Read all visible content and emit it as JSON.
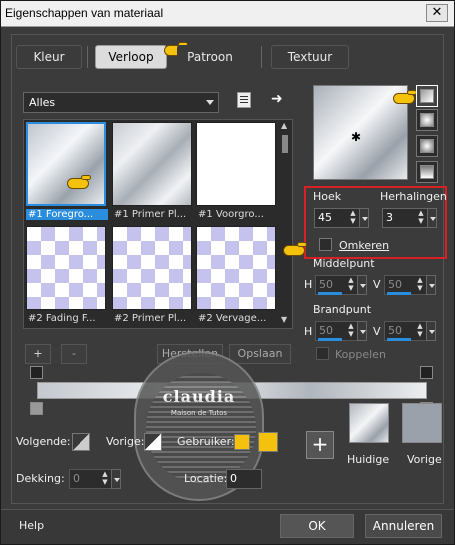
{
  "window": {
    "title": "Eigenschappen van materiaal",
    "close": "✕"
  },
  "tabs": [
    {
      "label": "Kleur"
    },
    {
      "label": "Verloop"
    },
    {
      "label": "Patroon"
    },
    {
      "label": "Textuur"
    }
  ],
  "library": {
    "filter": "Alles",
    "items": [
      {
        "caption": "#1 Foregro..."
      },
      {
        "caption": "#1 Primer Pl..."
      },
      {
        "caption": "#1 Voorgro..."
      },
      {
        "caption": "#2 Fading F..."
      },
      {
        "caption": "#2 Primer Pl..."
      },
      {
        "caption": "#2 Vervage..."
      }
    ],
    "add": "+",
    "remove": "-",
    "reset": "Herstellen",
    "save": "Opslaan"
  },
  "settings": {
    "angle_label": "Hoek",
    "angle_value": "45",
    "repeats_label": "Herhalingen",
    "repeats_value": "3",
    "invert_label": "Omkeren",
    "center_label": "Middelpunt",
    "center_h_label": "H",
    "center_h_value": "50",
    "center_v_label": "V",
    "center_v_value": "50",
    "focus_label": "Brandpunt",
    "focus_h_label": "H",
    "focus_h_value": "50",
    "focus_v_label": "V",
    "focus_v_value": "50",
    "link_label": "Koppelen"
  },
  "colors": {
    "next_label": "Volgende:",
    "prev_label": "Vorige:",
    "user_label": "Gebruiker:",
    "user_color": "#f4c20d",
    "opacity_label": "Dekking:",
    "opacity_value": "0",
    "location_label": "Locatie:",
    "location_value": "0"
  },
  "preview": {
    "add": "+",
    "current_label": "Huidige",
    "previous_label": "Vorige"
  },
  "watermark": {
    "text": "claudia",
    "sub": "Maison de Tutos"
  },
  "footer": {
    "help": "Help",
    "ok": "OK",
    "cancel": "Annuleren"
  }
}
